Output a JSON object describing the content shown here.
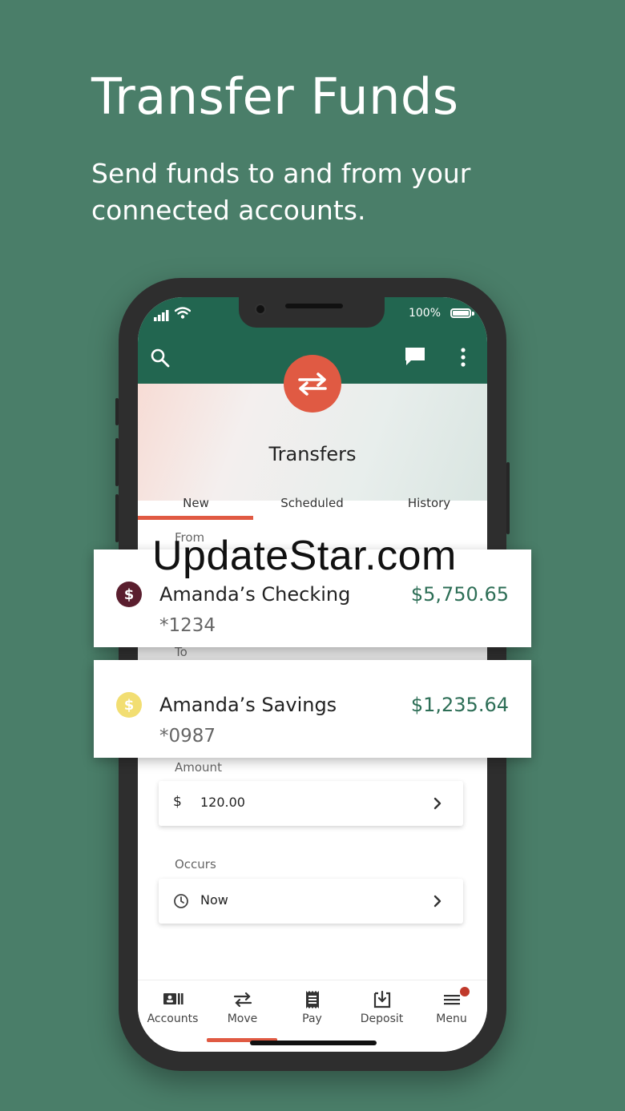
{
  "hero": {
    "title": "Transfer Funds",
    "subtitle": "Send funds to and from your connected accounts."
  },
  "status_bar": {
    "battery": "100%"
  },
  "header": {
    "icons": [
      "search-icon",
      "chat-icon",
      "more-vertical-icon"
    ]
  },
  "banner": {
    "title": "Transfers",
    "icon": "swap-arrows-icon"
  },
  "tabs": [
    {
      "label": "New",
      "active": true
    },
    {
      "label": "Scheduled",
      "active": false
    },
    {
      "label": "History",
      "active": false
    }
  ],
  "form": {
    "from_label": "From",
    "to_label": "To",
    "amount_label": "Amount",
    "amount_currency": "$",
    "amount_value": "120.00",
    "occurs_label": "Occurs",
    "occurs_value": "Now"
  },
  "from_account": {
    "name": "Amanda’s Checking",
    "number": "*1234",
    "balance": "$5,750.65",
    "icon": "dollar-icon",
    "icon_color": "#5a1e2e"
  },
  "to_account": {
    "name": "Amanda’s Savings",
    "number": "*0987",
    "balance": "$1,235.64",
    "icon": "dollar-icon",
    "icon_color": "#f2de72"
  },
  "nav": [
    {
      "label": "Accounts",
      "icon": "accounts-icon",
      "active": false
    },
    {
      "label": "Move",
      "icon": "move-arrows-icon",
      "active": true
    },
    {
      "label": "Pay",
      "icon": "receipt-icon",
      "active": false
    },
    {
      "label": "Deposit",
      "icon": "deposit-icon",
      "active": false
    },
    {
      "label": "Menu",
      "icon": "menu-icon",
      "active": false
    }
  ],
  "watermark": "UpdateStar.com",
  "colors": {
    "background": "#4a7e69",
    "header": "#226650",
    "accent": "#e05a43",
    "balance": "#2d6e56"
  }
}
